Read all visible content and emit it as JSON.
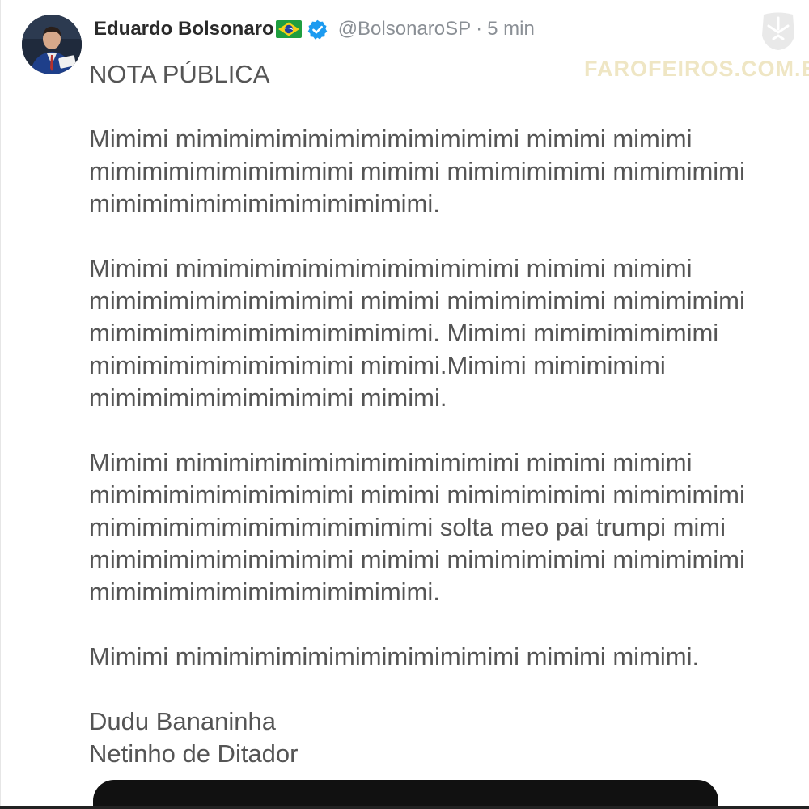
{
  "author": {
    "display_name": "Eduardo Bolsonaro",
    "handle": "@BolsonaroSP",
    "separator": "·",
    "timestamp": "5 min",
    "flag_icon": "brazil-flag-icon",
    "verified_icon": "verified-badge-icon",
    "verified_color": "#1d9bf0"
  },
  "tweet": {
    "title": "NOTA PÚBLICA",
    "paragraphs": [
      "Mimimi mimimimimimimimimimimimimi mimimi mimimi mimimimimimimimimimi mimimi mimimimimimi mimimimimi mimimimimimimimimimimimimi.",
      "Mimimi mimimimimimimimimimimimimi mimimi mimimi mimimimimimimimimimi mimimi mimimimimimi mimimimimi mimimimimimimimimimimimimi. Mimimi mimimimimimimi mimimimimimimimimimi mimimi.Mimimi mimimimimi mimimimimimimimimimi mimimi.",
      "Mimimi mimimimimimimimimimimimimi mimimi mimimi mimimimimimimimimimi mimimi mimimimimimi mimimimimi mimimimimimimimimimimimimi solta meo pai trumpi mimi mimimimimimimimimimi mimimi mimimimimimi mimimimimi mimimimimimimimimimimimimi.",
      "Mimimi mimimimimimimimimimimimimi mimimi mimimi."
    ],
    "signature_line_1": "Dudu Bananinha",
    "signature_line_2": "Netinho de Ditador"
  },
  "watermark": {
    "text": "FAROFEIROS.COM.BR",
    "logo_icon": "farofeiros-logo-icon",
    "color": "#efe6c4"
  },
  "colors": {
    "text": "#555555",
    "name": "#2a2a2a",
    "muted": "#8a8f95",
    "background": "#ffffff"
  }
}
